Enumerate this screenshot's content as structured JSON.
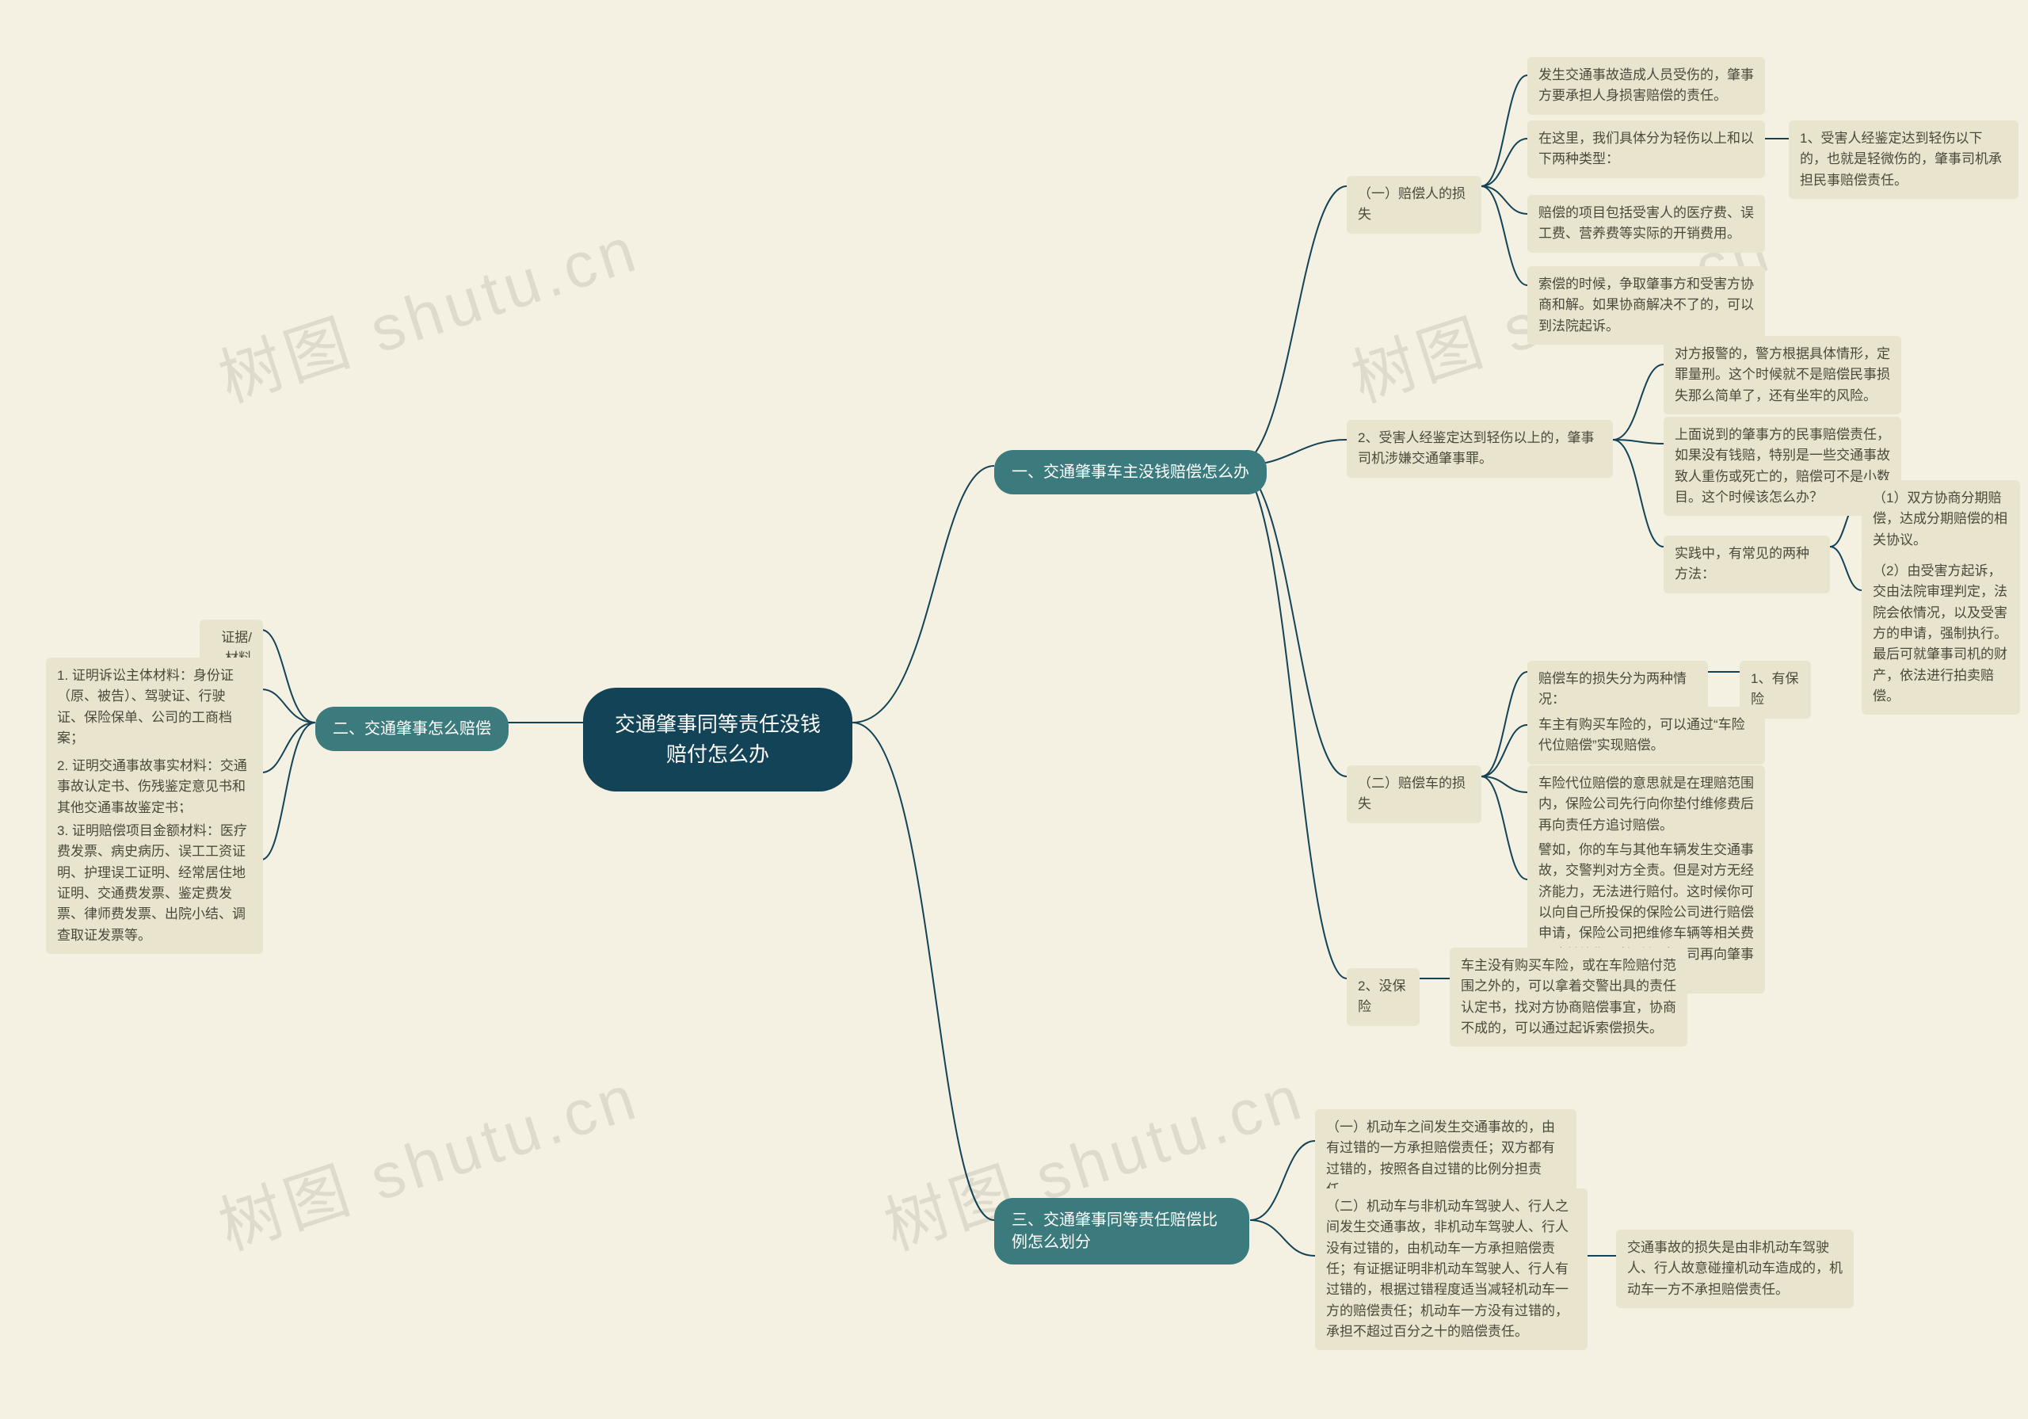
{
  "watermark": "树图 shutu.cn",
  "root": "交通肇事同等责任没钱赔付怎么办",
  "b1": {
    "title": "一、交通肇事车主没钱赔偿怎么办"
  },
  "b2": {
    "title": "二、交通肇事怎么赔偿",
    "c0": "证据/材料",
    "c1": "1. 证明诉讼主体材料：身份证（原、被告）、驾驶证、行驶证、保险保单、公司的工商档案；",
    "c2": "2. 证明交通事故事实材料：交通事故认定书、伤残鉴定意见书和其他交通事故鉴定书；",
    "c3": "3. 证明赔偿项目金额材料：医疗费发票、病史病历、误工工资证明、护理误工证明、经常居住地证明、交通费发票、鉴定费发票、律师费发票、出院小结、调查取证发票等。"
  },
  "b3": {
    "title": "三、交通肇事同等责任赔偿比例怎么划分",
    "c1": "（一）机动车之间发生交通事故的，由有过错的一方承担赔偿责任；双方都有过错的，按照各自过错的比例分担责任。",
    "c2": "（二）机动车与非机动车驾驶人、行人之间发生交通事故，非机动车驾驶人、行人没有过错的，由机动车一方承担赔偿责任；有证据证明非机动车驾驶人、行人有过错的，根据过错程度适当减轻机动车一方的赔偿责任；机动车一方没有过错的，承担不超过百分之十的赔偿责任。",
    "c3": "交通事故的损失是由非机动车驾驶人、行人故意碰撞机动车造成的，机动车一方不承担赔偿责任。"
  },
  "s1_1": {
    "title": "（一）赔偿人的损失",
    "a1": "发生交通事故造成人员受伤的，肇事方要承担人身损害赔偿的责任。",
    "a2": "在这里，我们具体分为轻伤以上和以下两种类型：",
    "a2x": "1、受害人经鉴定达到轻伤以下的，也就是轻微伤的，肇事司机承担民事赔偿责任。",
    "a3": "赔偿的项目包括受害人的医疗费、误工费、营养费等实际的开销费用。",
    "a4": "索偿的时候，争取肇事方和受害方协商和解。如果协商解决不了的，可以到法院起诉。"
  },
  "s1_2": {
    "title": "2、受害人经鉴定达到轻伤以上的，肇事司机涉嫌交通肇事罪。",
    "a1": "对方报警的，警方根据具体情形，定罪量刑。这个时候就不是赔偿民事损失那么简单了，还有坐牢的风险。",
    "a2": "上面说到的肇事方的民事赔偿责任，如果没有钱赔，特别是一些交通事故致人重伤或死亡的，赔偿可不是小数目。这个时候该怎么办？",
    "a3": "实践中，有常见的两种方法：",
    "a3a": "（1）双方协商分期赔偿，达成分期赔偿的相关协议。",
    "a3b": "（2）由受害方起诉，交由法院审理判定，法院会依情况，以及受害方的申请，强制执行。最后可就肇事司机的财产，依法进行拍卖赔偿。"
  },
  "s1_3": {
    "title": "（二）赔偿车的损失",
    "a1": "赔偿车的损失分为两种情况：",
    "a1x": "1、有保险",
    "a2": "车主有购买车险的，可以通过“车险代位赔偿”实现赔偿。",
    "a3": "车险代位赔偿的意思就是在理赔范围内，保险公司先行向你垫付维修费后再向责任方追讨赔偿。",
    "a4": "譬如，你的车与其他车辆发生交通事故，交警判对方全责。但是对方无经济能力，无法进行赔付。这时候你可以向自己所投保的保险公司进行赔偿申请，保险公司把维修车辆等相关费用赔付给你，然后保险公司再向肇事方追讨赔偿款。"
  },
  "s1_4": {
    "title": "2、没保险",
    "a1": "车主没有购买车险，或在车险赔付范围之外的，可以拿着交警出具的责任认定书，找对方协商赔偿事宜，协商不成的，可以通过起诉索偿损失。"
  }
}
